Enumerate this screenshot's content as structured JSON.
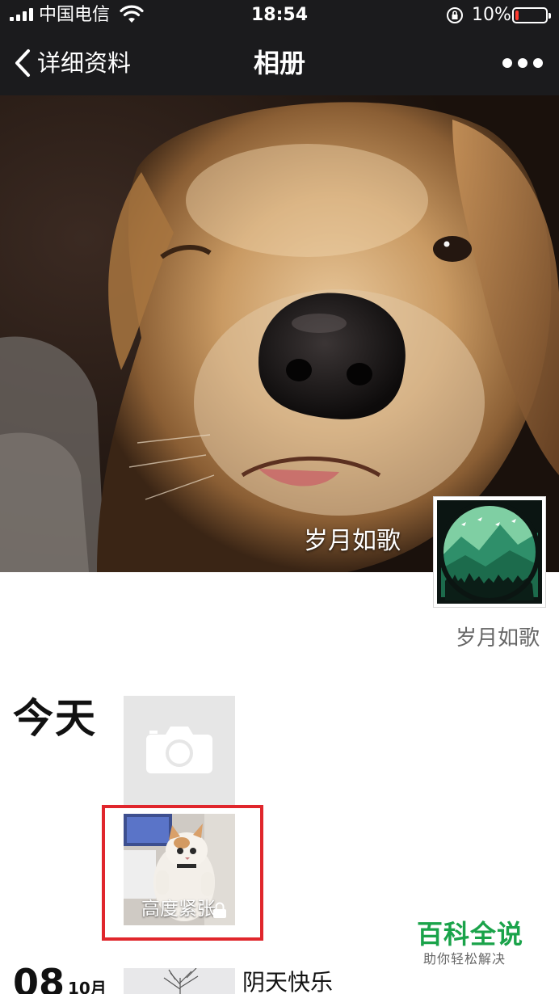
{
  "status_bar": {
    "carrier": "中国电信",
    "time": "18:54",
    "battery_percent_text": "10%",
    "battery_level": 0.1,
    "signal_icon": "cellular-signal-icon",
    "wifi_icon": "wifi-icon",
    "rotation_lock_icon": "rotation-lock-icon"
  },
  "nav": {
    "back_label": "详细资料",
    "title": "相册",
    "more_icon": "more-icon"
  },
  "profile": {
    "cover_name": "岁月如歌",
    "signature": "岁月如歌"
  },
  "timeline": {
    "today_label": "今天",
    "camera_icon": "camera-icon",
    "today_post_caption": "高度紧张",
    "second_post": {
      "day": "08",
      "month": "10月",
      "text": "阴天快乐"
    }
  },
  "watermark": {
    "title": "百科全说",
    "subtitle": "助你轻松解决"
  },
  "colors": {
    "nav_background": "#1b1b1d",
    "highlight_border": "#e0262c",
    "watermark_green": "#1aa34a",
    "battery_red": "#ff3b30"
  }
}
